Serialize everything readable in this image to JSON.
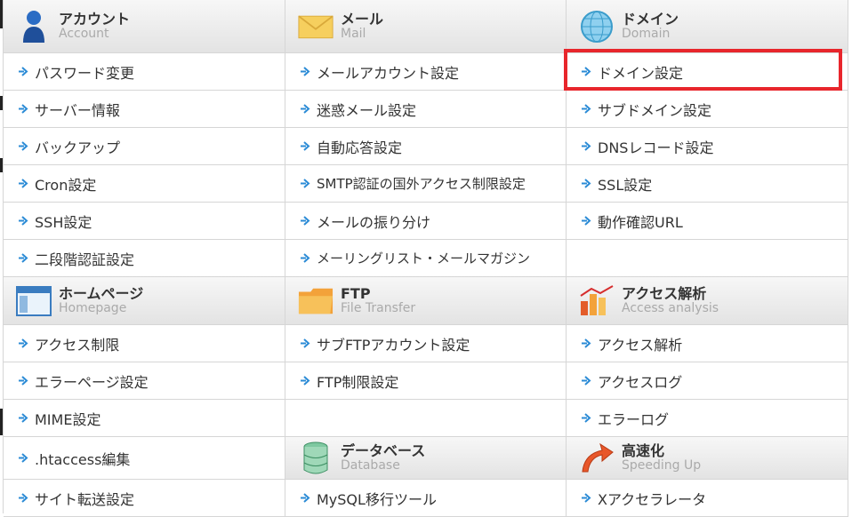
{
  "sections": {
    "account": {
      "jp": "アカウント",
      "en": "Account",
      "icon": "user-icon",
      "items": [
        "パスワード変更",
        "サーバー情報",
        "バックアップ",
        "Cron設定",
        "SSH設定",
        "二段階認証設定"
      ]
    },
    "mail": {
      "jp": "メール",
      "en": "Mail",
      "icon": "envelope-icon",
      "items": [
        "メールアカウント設定",
        "迷惑メール設定",
        "自動応答設定",
        "SMTP認証の国外アクセス制限設定",
        "メールの振り分け",
        "メーリングリスト・メールマガジン"
      ]
    },
    "domain": {
      "jp": "ドメイン",
      "en": "Domain",
      "icon": "globe-icon",
      "items": [
        "ドメイン設定",
        "サブドメイン設定",
        "DNSレコード設定",
        "SSL設定",
        "動作確認URL"
      ]
    },
    "homepage": {
      "jp": "ホームページ",
      "en": "Homepage",
      "icon": "browser-window-icon",
      "items": [
        "アクセス制限",
        "エラーページ設定",
        "MIME設定",
        ".htaccess編集",
        "サイト転送設定"
      ]
    },
    "ftp": {
      "jp": "FTP",
      "en": "File Transfer",
      "icon": "folder-icon",
      "items": [
        "サブFTPアカウント設定",
        "FTP制限設定"
      ]
    },
    "database": {
      "jp": "データベース",
      "en": "Database",
      "icon": "database-icon",
      "items": [
        "MySQL移行ツール"
      ]
    },
    "analytics": {
      "jp": "アクセス解析",
      "en": "Access analysis",
      "icon": "chart-icon",
      "items": [
        "アクセス解析",
        "アクセスログ",
        "エラーログ"
      ]
    },
    "speed": {
      "jp": "高速化",
      "en": "Speeding Up",
      "icon": "speed-arrow-icon",
      "items": [
        "Xアクセラレータ"
      ]
    }
  },
  "highlight": {
    "target": "ドメイン設定",
    "color": "#e8262c"
  }
}
